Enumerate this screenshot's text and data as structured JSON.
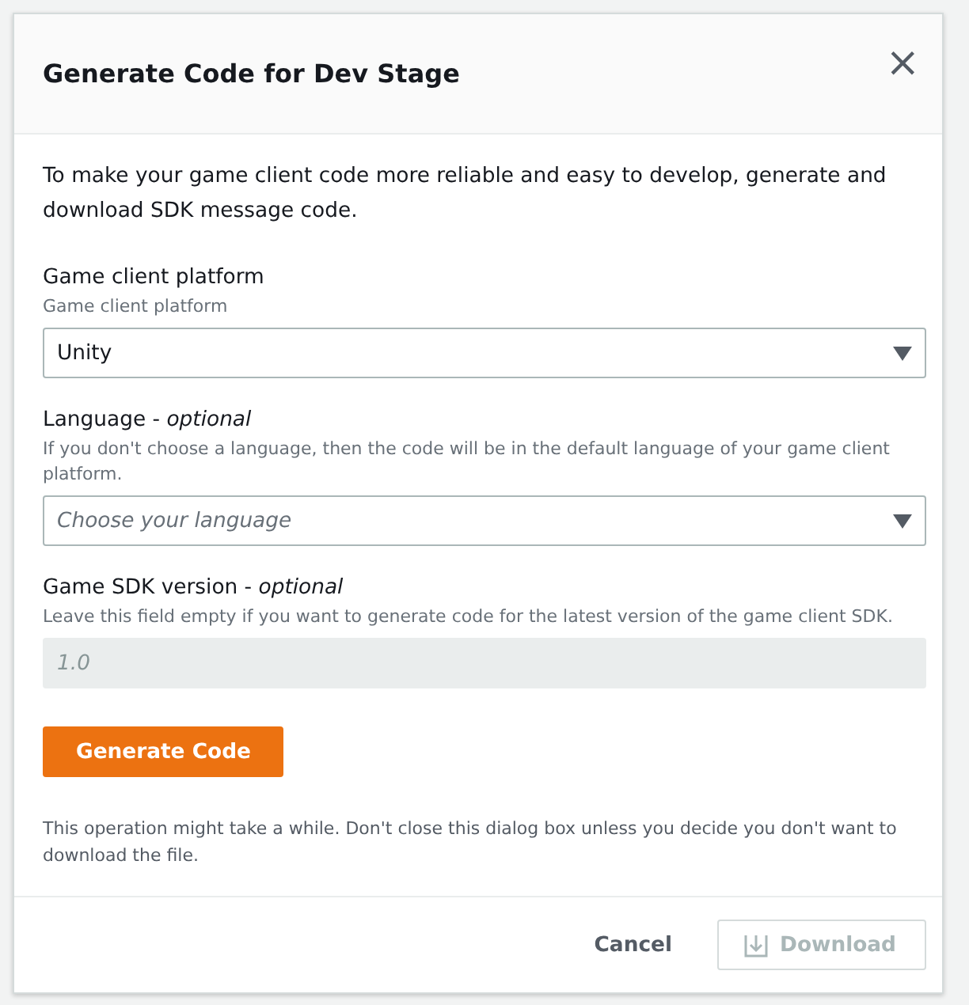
{
  "dialog": {
    "title": "Generate Code for Dev Stage",
    "close": "×"
  },
  "intro": "To make your game client code more reliable and easy to develop, generate and download SDK message code.",
  "fields": [
    {
      "kind": "select",
      "label": "Game client platform",
      "description": "Game client platform",
      "value": "Unity",
      "disabled": false
    },
    {
      "kind": "select",
      "label": "Language - ",
      "optional": "optional",
      "description": "If you don't choose a language, then the code will be in the default language of your game client platform.",
      "placeholder": "Choose your language",
      "disabled": false
    },
    {
      "kind": "text",
      "label": "Game SDK version - ",
      "optional": "optional",
      "description": "Leave this field empty if you want to generate code for the latest version of the game client SDK.",
      "placeholder": "1.0",
      "disabled": true
    }
  ],
  "generate_button": "Generate Code",
  "note": "This operation might take a while. Don't close this dialog box unless you decide you don't want to download the file.",
  "footer": {
    "cancel": "Cancel",
    "download": {
      "label": "Download",
      "disabled": true
    }
  }
}
